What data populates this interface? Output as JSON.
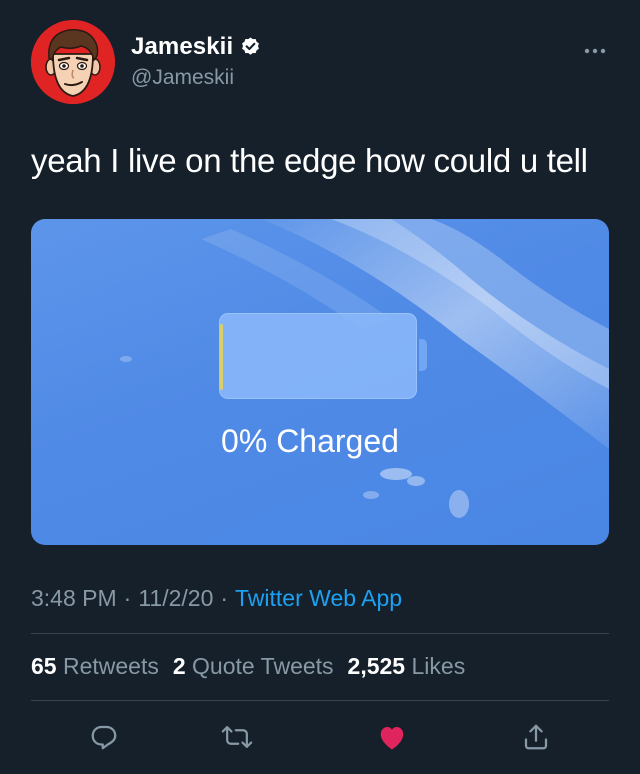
{
  "author": {
    "display_name": "Jameskii",
    "handle": "@Jameskii",
    "verified": true
  },
  "tweet": {
    "text": "yeah I live on the edge how could u tell"
  },
  "media": {
    "charge_label": "0% Charged",
    "battery_level_percent": 0
  },
  "meta": {
    "time": "3:48 PM",
    "separator": "·",
    "date": "11/2/20",
    "source": "Twitter Web App"
  },
  "stats": {
    "retweets_count": "65",
    "retweets_label": "Retweets",
    "quote_count": "2",
    "quote_label": "Quote Tweets",
    "likes_count": "2,525",
    "likes_label": "Likes"
  },
  "colors": {
    "background": "#15202b",
    "accent": "#1da1f2",
    "like": "#e0245e",
    "secondary_text": "#8899a6"
  },
  "icons": {
    "reply": "speech-bubble",
    "retweet": "retweet-arrows",
    "like": "heart-filled",
    "share": "share-upload",
    "more": "ellipsis"
  }
}
